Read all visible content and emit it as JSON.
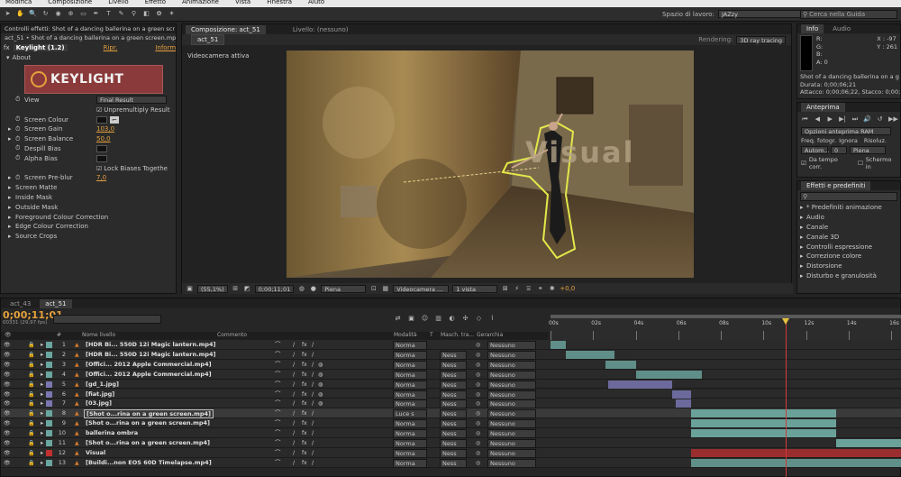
{
  "menubar": {
    "items": [
      "Modifica",
      "Composizione",
      "Livello",
      "Effetto",
      "Animazione",
      "Vista",
      "Finestra",
      "Aiuto"
    ]
  },
  "toolbar": {
    "workspace_label": "Spazio di lavoro:",
    "workspace_value": "JAZzy",
    "search_placeholder": "Cerca nella Guida"
  },
  "effects_panel": {
    "tab_title": "Controlli effetti: Shot of a dancing ballerina on a green scr",
    "breadcrumb": "act_51 • Shot of a dancing ballerina on a green screen.mp4",
    "plugin_name": "Keylight (1.2)",
    "reset_label": "Ripr.",
    "info_label": "Inform",
    "about_label": "About",
    "logo_text": "KEYLIGHT",
    "properties": [
      {
        "name": "View",
        "value": "Final Result",
        "kind": "select"
      },
      {
        "name": "",
        "value": "Unpremultiply Result",
        "kind": "checkbox"
      },
      {
        "name": "Screen Colour",
        "value": "",
        "kind": "color"
      },
      {
        "name": "Screen Gain",
        "value": "103,0",
        "kind": "number"
      },
      {
        "name": "Screen Balance",
        "value": "50,0",
        "kind": "number"
      },
      {
        "name": "Despill Bias",
        "value": "",
        "kind": "color"
      },
      {
        "name": "Alpha Bias",
        "value": "",
        "kind": "color"
      },
      {
        "name": "",
        "value": "Lock Biases Togethe",
        "kind": "checkbox"
      },
      {
        "name": "Screen Pre-blur",
        "value": "7,0",
        "kind": "number"
      }
    ],
    "groups": [
      "Screen Matte",
      "Inside Mask",
      "Outside Mask",
      "Foreground Colour Correction",
      "Edge Colour Correction",
      "Source Crops"
    ]
  },
  "composition": {
    "tab_title": "Composizione: act_51",
    "layer_tab": "Livello: (nessuno)",
    "comp_name": "act_51",
    "renderer_label": "Rendering:",
    "renderer_value": "3D ray tracing",
    "camera_label": "Videocamera attiva",
    "overlay_text": "Visual",
    "zoom": "(55,1%)",
    "timecode": "0;00;11;01",
    "resolution": "Piena",
    "camera_select": "Videocamera ...",
    "view_select": "1 vista",
    "exposure": "+0,0"
  },
  "info_panel": {
    "tabs": [
      "Info",
      "Audio"
    ],
    "r_label": "R:",
    "g_label": "G:",
    "b_label": "B:",
    "a_label": "A:",
    "a_value": "0",
    "x_value": "X : -97",
    "y_value": "Y : 261",
    "clip_name": "Shot of a dancing ballerina on a g",
    "duration": "Durata: 0;00;06;21",
    "in_out": "Attacco: 0;00;06;22, Stacco: 0;00;"
  },
  "preview_panel": {
    "title": "Anteprima",
    "ram_options": "Opzioni anteprima RAM",
    "fps_label": "Freq. fotogr.",
    "skip_label": "Ignora",
    "res_label": "Risoluz.",
    "fps_value": "Autom...",
    "skip_value": "0",
    "res_value": "Piena",
    "current_time_label": "Da tempo corr.",
    "fullscreen_label": "Schermo in"
  },
  "effects_presets": {
    "title": "Effetti e predefiniti",
    "search_placeholder": "",
    "items": [
      "* Predefiniti animazione",
      "Audio",
      "Canale",
      "Canale 3D",
      "Controlli espressione",
      "Correzione colore",
      "Distorsione",
      "Disturbo e granulosità"
    ]
  },
  "timeline": {
    "tabs": [
      "act_43",
      "act_51"
    ],
    "timecode": "0;00;11;01",
    "fps_info": "00331 (29,97 fps)",
    "column_headers": {
      "name": "Nome livello",
      "comment": "Commento",
      "mode": "Modalità",
      "trkmat": "T",
      "mask": "Masch. tra...",
      "parent": "Gerarchia"
    },
    "ruler_labels": [
      "00s",
      "02s",
      "04s",
      "06s",
      "08s",
      "10s",
      "12s",
      "14s",
      "16s"
    ],
    "layers": [
      {
        "num": "1",
        "name": "[HDR Bi... 550D 12i Magic lantern.mp4]",
        "mode": "Norma",
        "mask": "",
        "parent": "Nessuno",
        "label_color": "#6aa6a0",
        "bar_color": "#5f8f88",
        "bar_start": 0,
        "bar_end": 0.7
      },
      {
        "num": "2",
        "name": "[HDR Bi... 550D 12i Magic lantern.mp4]",
        "mode": "Norma",
        "mask": "Ness",
        "parent": "Nessuno",
        "label_color": "#6aa6a0",
        "bar_color": "#5f8f88",
        "bar_start": 0.7,
        "bar_end": 3.0
      },
      {
        "num": "3",
        "name": "[Offici... 2012 Apple Commercial.mp4]",
        "mode": "Norma",
        "mask": "Ness",
        "parent": "Nessuno",
        "label_color": "#6aa6a0",
        "bar_color": "#5f8f88",
        "bar_start": 2.6,
        "bar_end": 4.0
      },
      {
        "num": "4",
        "name": "[Offici... 2012 Apple Commercial.mp4]",
        "mode": "Norma",
        "mask": "Ness",
        "parent": "Nessuno",
        "label_color": "#6aa6a0",
        "bar_color": "#5f8f88",
        "bar_start": 4.0,
        "bar_end": 7.1
      },
      {
        "num": "5",
        "name": "[gd_1.jpg]",
        "mode": "Norma",
        "mask": "Ness",
        "parent": "Nessuno",
        "label_color": "#7a76b0",
        "bar_color": "#6c6a9c",
        "bar_start": 2.7,
        "bar_end": 5.7
      },
      {
        "num": "6",
        "name": "[fiat.jpg]",
        "mode": "Norma",
        "mask": "Ness",
        "parent": "Nessuno",
        "label_color": "#7a76b0",
        "bar_color": "#6c6a9c",
        "bar_start": 5.7,
        "bar_end": 6.6
      },
      {
        "num": "7",
        "name": "[03.jpg]",
        "mode": "Norma",
        "mask": "Ness",
        "parent": "Nessuno",
        "label_color": "#7a76b0",
        "bar_color": "#6c6a9c",
        "bar_start": 5.9,
        "bar_end": 6.6
      },
      {
        "num": "8",
        "name": "[Shot o...rina on a green screen.mp4]",
        "mode": "Luce s",
        "mask": "Ness",
        "parent": "Nessuno",
        "label_color": "#6aa6a0",
        "bar_color": "#6aa29a",
        "bar_start": 6.6,
        "bar_end": 13.4
      },
      {
        "num": "9",
        "name": "[Shot o...rina on a green screen.mp4]",
        "mode": "Norma",
        "mask": "Ness",
        "parent": "Nessuno",
        "label_color": "#6aa6a0",
        "bar_color": "#6aa29a",
        "bar_start": 6.6,
        "bar_end": 13.4
      },
      {
        "num": "10",
        "name": "ballerina ombra",
        "mode": "Norma",
        "mask": "Ness",
        "parent": "Nessuno",
        "label_color": "#6aa6a0",
        "bar_color": "#6aa29a",
        "bar_start": 6.6,
        "bar_end": 13.4
      },
      {
        "num": "11",
        "name": "[Shot o...rina on a green screen.mp4]",
        "mode": "Norma",
        "mask": "Ness",
        "parent": "Nessuno",
        "label_color": "#6aa6a0",
        "bar_color": "#6aa29a",
        "bar_start": 13.4,
        "bar_end": 16.5
      },
      {
        "num": "12",
        "name": "Visual",
        "mode": "Norma",
        "mask": "Ness",
        "parent": "Nessuno",
        "label_color": "#c23030",
        "bar_color": "#9a2e2e",
        "bar_start": 6.6,
        "bar_end": 16.5
      },
      {
        "num": "13",
        "name": "[Buildi...non EOS 60D Timelapse.mp4]",
        "mode": "Norma",
        "mask": "Ness",
        "parent": "Nessuno",
        "label_color": "#6aa6a0",
        "bar_color": "#5f8f88",
        "bar_start": 6.6,
        "bar_end": 16.5
      }
    ],
    "playhead_seconds": 11.03
  }
}
